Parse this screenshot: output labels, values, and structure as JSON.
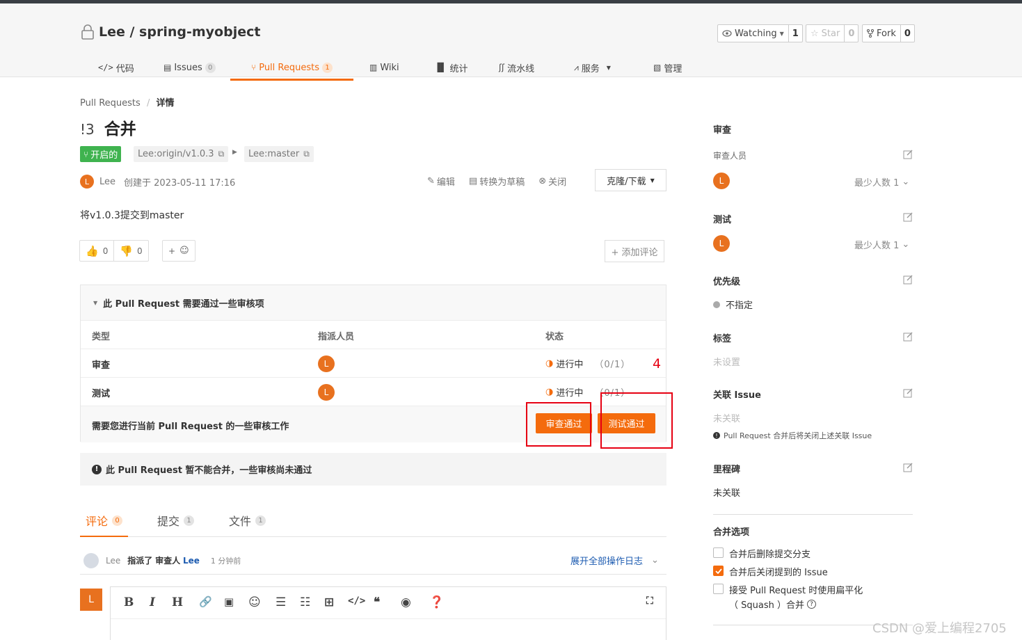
{
  "repo": {
    "owner_repo": "Lee / spring-myobject",
    "watch": {
      "label": "Watching",
      "count": "1"
    },
    "star": {
      "label": "Star",
      "count": "0"
    },
    "fork": {
      "label": "Fork",
      "count": "0"
    }
  },
  "tabs": [
    {
      "label": "代码"
    },
    {
      "label": "Issues",
      "badge": "0"
    },
    {
      "label": "Pull Requests",
      "badge": "1"
    },
    {
      "label": "Wiki"
    },
    {
      "label": "统计"
    },
    {
      "label": "流水线"
    },
    {
      "label": "服务"
    },
    {
      "label": "管理"
    }
  ],
  "breadcrumb": {
    "root": "Pull Requests",
    "sep": "/",
    "current": "详情"
  },
  "pr": {
    "number": "!3",
    "title": "合并",
    "state": "开启的",
    "source_branch": "Lee:origin/v1.0.3",
    "target_branch": "Lee:master",
    "author_initial": "L",
    "author": "Lee",
    "created": "创建于 2023-05-11 17:16",
    "actions": {
      "edit": "编辑",
      "draft": "转换为草稿",
      "close": "关闭"
    },
    "clone": "克隆/下载",
    "description": "将v1.0.3提交到master",
    "reactions": {
      "up": "0",
      "down": "0",
      "add": "+"
    },
    "add_comment": "+ 添加评论"
  },
  "review": {
    "header": "此 Pull Request 需要通过一些审核项",
    "columns": {
      "type": "类型",
      "assignee": "指派人员",
      "status": "状态"
    },
    "rows": [
      {
        "type": "审查",
        "initial": "L",
        "status": "进行中",
        "progress": "（0/1）"
      },
      {
        "type": "测试",
        "initial": "L",
        "status": "进行中",
        "progress": "（0/1）"
      }
    ],
    "footer": "需要您进行当前 Pull Request 的一些审核工作",
    "approve_review": "审查通过",
    "approve_test": "测试通过",
    "annotation": "4"
  },
  "warning": "此 Pull Request 暂不能合并，一些审核尚未通过",
  "content_tabs": [
    {
      "label": "评论",
      "badge": "0"
    },
    {
      "label": "提交",
      "badge": "1"
    },
    {
      "label": "文件",
      "badge": "1"
    }
  ],
  "log": {
    "user": "Lee",
    "action": "指派了",
    "role": "审查人",
    "target": "Lee",
    "time": "1 分钟前",
    "expand": "展开全部操作日志"
  },
  "editor": {
    "initial": "L"
  },
  "sidebar": {
    "review_title": "审查",
    "reviewers_label": "审查人员",
    "reviewer_initial": "L",
    "reviewer_min": "最少人数 1",
    "test_title": "测试",
    "tester_initial": "L",
    "tester_min": "最少人数 1",
    "priority_title": "优先级",
    "priority_value": "不指定",
    "labels_title": "标签",
    "labels_value": "未设置",
    "issue_title": "关联 Issue",
    "issue_value": "未关联",
    "issue_note": "Pull Request 合并后将关闭上述关联 Issue",
    "milestone_title": "里程碑",
    "milestone_value": "未关联",
    "merge_title": "合并选项",
    "merge_opts": [
      {
        "label": "合并后删除提交分支",
        "checked": false
      },
      {
        "label": "合并后关闭提到的 Issue",
        "checked": true
      },
      {
        "label": "接受 Pull Request 时使用扁平化",
        "label2": "（ Squash ）合并",
        "checked": false
      }
    ]
  },
  "watermark": "CSDN @爱上编程2705"
}
